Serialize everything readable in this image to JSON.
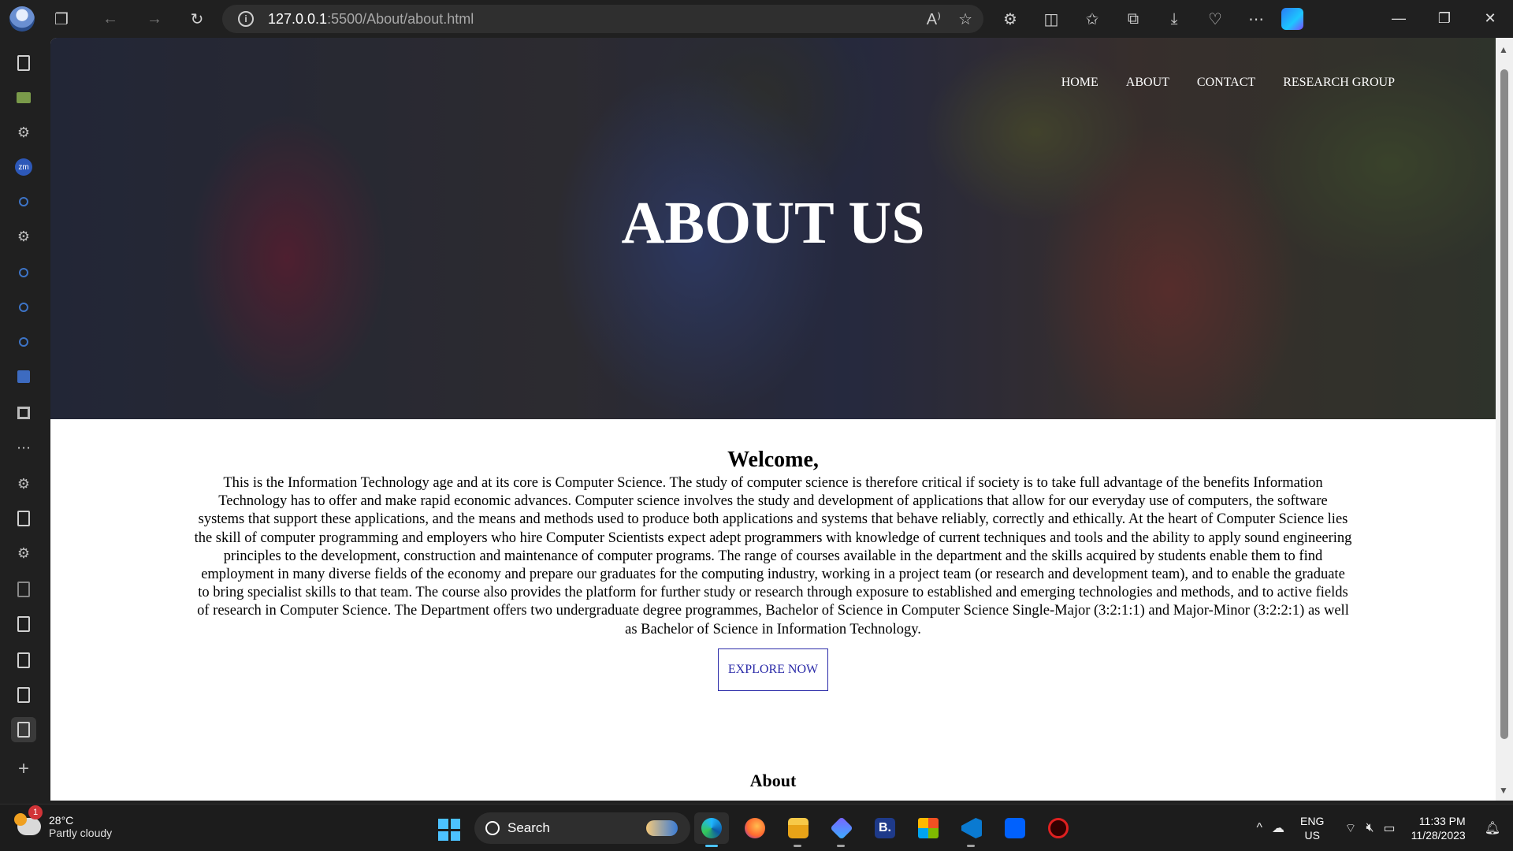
{
  "browser": {
    "url_host": "127.0.0.1",
    "url_path": ":5500/About/about.html",
    "icons": [
      "profile-icon",
      "tab-actions-icon",
      "back-icon",
      "forward-icon",
      "refresh-icon",
      "read-aloud-icon",
      "favorite-star-icon",
      "extensions-icon",
      "split-screen-icon",
      "favorites-icon",
      "collections-icon",
      "downloads-icon",
      "browser-essentials-icon",
      "more-icon",
      "copilot-icon"
    ]
  },
  "nav": {
    "items": [
      "HOME",
      "ABOUT",
      "CONTACT",
      "RESEARCH GROUP"
    ]
  },
  "hero": {
    "title": "ABOUT US"
  },
  "content": {
    "welcome": "Welcome,",
    "body": "This is the Information Technology age and at its core is Computer Science. The study of computer science is therefore critical if society is to take full advantage of the benefits Information Technology has to offer and make rapid economic advances. Computer science involves the study and development of applications that allow for our everyday use of computers, the software systems that support these applications, and the means and methods used to produce both applications and systems that behave reliably, correctly and ethically. At the heart of Computer Science lies the skill of computer programming and employers who hire Computer Scientists expect adept programmers with knowledge of current techniques and tools and the ability to apply sound engineering principles to the development, construction and maintenance of computer programs. The range of courses available in the department and the skills acquired by students enable them to find employment in many diverse fields of the economy and prepare our graduates for the computing industry, working in a project team (or research and development team), and to enable the graduate to bring specialist skills to that team. The course also provides the platform for further study or research through exposure to established and emerging technologies and methods, and to active fields of research in Computer Science. The Department offers two undergraduate degree programmes, Bachelor of Science in Computer Science Single-Major (3:2:1:1) and Major-Minor (3:2:2:1) as well as Bachelor of Science in Information Technology.",
    "button": "EXPLORE NOW",
    "about_heading": "About"
  },
  "taskbar": {
    "weather_badge": "1",
    "temperature": "28°C",
    "condition": "Partly cloudy",
    "search_label": "Search",
    "lang_top": "ENG",
    "lang_bottom": "US",
    "time": "11:33 PM",
    "date": "11/28/2023",
    "accent": "#4cc2ff"
  }
}
